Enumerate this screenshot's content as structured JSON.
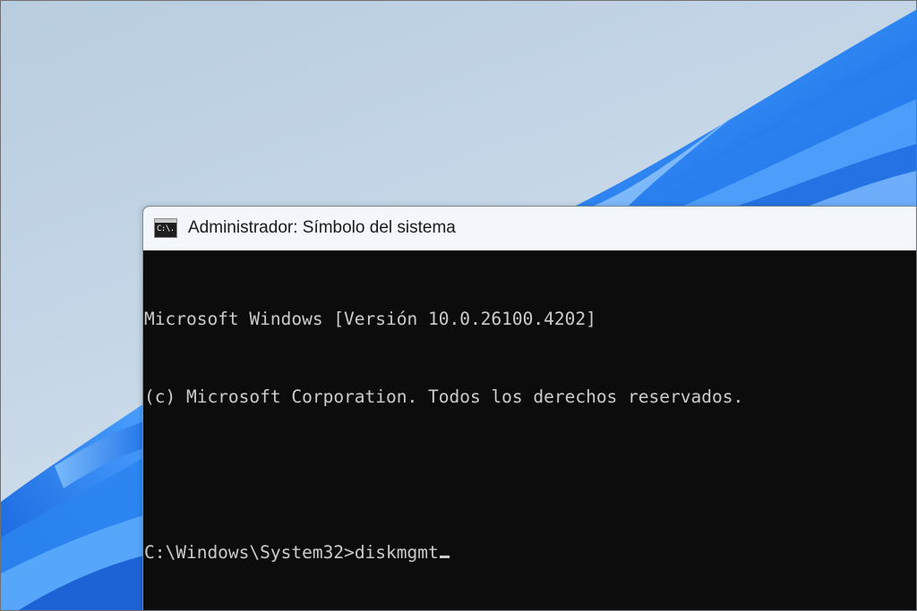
{
  "window": {
    "title": "Administrador: Símbolo del sistema",
    "icon": "cmd-icon",
    "icon_glyph": "C:\\."
  },
  "console": {
    "lines": [
      "Microsoft Windows [Versión 10.0.26100.4202]",
      "(c) Microsoft Corporation. Todos los derechos reservados.",
      ""
    ],
    "prompt": "C:\\Windows\\System32>",
    "input": "diskmgmt"
  },
  "colors": {
    "console_background": "#0c0c0c",
    "console_text": "#cccccc",
    "titlebar_background": "#f3f6fa",
    "wallpaper_accent": "#1a73e8"
  }
}
